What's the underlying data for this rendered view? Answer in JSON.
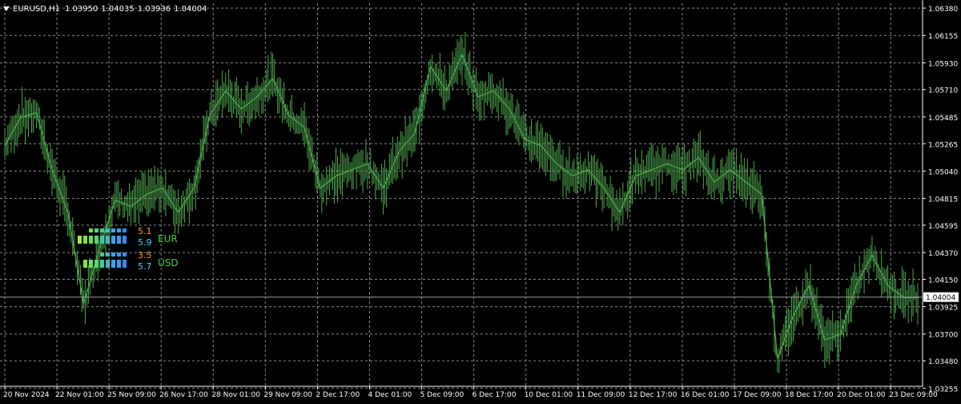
{
  "header": {
    "symbol": "EURUSD,H1",
    "open": "1.03950",
    "high": "1.04035",
    "low": "1.03936",
    "close": "1.04004"
  },
  "colors": {
    "background": "#000000",
    "grid": "#8a8a8a",
    "price_line": "#4fa84f",
    "axis": "#ffffff",
    "ask_line": "#ffffff",
    "strength_orange": "#ff9a30",
    "strength_cyan": "#40d8ff",
    "strength_label": "#40d040"
  },
  "strength_meter": {
    "rows": [
      {
        "currency": "EUR",
        "values": [
          "5.1",
          "5.9"
        ]
      },
      {
        "currency": "USD",
        "values": [
          "3.5",
          "5.7"
        ]
      }
    ]
  },
  "chart_data": {
    "type": "line",
    "title": "",
    "xlabel": "",
    "ylabel": "",
    "ylim": [
      1.0327,
      1.0642
    ],
    "y_ticks": [
      "1.06380",
      "1.06155",
      "1.05930",
      "1.05710",
      "1.05485",
      "1.05265",
      "1.05040",
      "1.04815",
      "1.04595",
      "1.04370",
      "1.04150",
      "1.03925",
      "1.03700",
      "1.03480",
      "1.03255"
    ],
    "x_ticks": [
      "20 Nov 2024",
      "22 Nov 01:00",
      "25 Nov 09:00",
      "26 Nov 17:00",
      "28 Nov 01:00",
      "29 Nov 09:00",
      "2 Dec 17:00",
      "4 Dec 01:00",
      "5 Dec 09:00",
      "6 Dec 17:00",
      "10 Dec 01:00",
      "11 Dec 09:00",
      "12 Dec 17:00",
      "16 Dec 01:00",
      "17 Dec 09:00",
      "18 Dec 17:00",
      "20 Dec 01:00",
      "23 Dec 09:00"
    ],
    "current_price": "1.04004",
    "grid": true,
    "series": [
      {
        "values": [
          {
            "x": "20 Nov 2024",
            "y": 1.0525
          },
          {
            "x": "20 Nov 18:00",
            "y": 1.0548
          },
          {
            "x": "21 Nov 06:00",
            "y": 1.0552
          },
          {
            "x": "21 Nov 18:00",
            "y": 1.0505
          },
          {
            "x": "22 Nov 01:00",
            "y": 1.047
          },
          {
            "x": "22 Nov 08:00",
            "y": 1.0395
          },
          {
            "x": "22 Nov 16:00",
            "y": 1.044
          },
          {
            "x": "25 Nov 01:00",
            "y": 1.048
          },
          {
            "x": "25 Nov 09:00",
            "y": 1.0475
          },
          {
            "x": "25 Nov 18:00",
            "y": 1.0485
          },
          {
            "x": "26 Nov 06:00",
            "y": 1.049
          },
          {
            "x": "26 Nov 17:00",
            "y": 1.047
          },
          {
            "x": "27 Nov 04:00",
            "y": 1.049
          },
          {
            "x": "27 Nov 14:00",
            "y": 1.055
          },
          {
            "x": "28 Nov 01:00",
            "y": 1.057
          },
          {
            "x": "28 Nov 14:00",
            "y": 1.0555
          },
          {
            "x": "29 Nov 01:00",
            "y": 1.0565
          },
          {
            "x": "29 Nov 09:00",
            "y": 1.058
          },
          {
            "x": "29 Nov 20:00",
            "y": 1.055
          },
          {
            "x": "2 Dec 06:00",
            "y": 1.054
          },
          {
            "x": "2 Dec 17:00",
            "y": 1.049
          },
          {
            "x": "3 Dec 06:00",
            "y": 1.05
          },
          {
            "x": "3 Dec 18:00",
            "y": 1.0505
          },
          {
            "x": "4 Dec 01:00",
            "y": 1.051
          },
          {
            "x": "4 Dec 12:00",
            "y": 1.049
          },
          {
            "x": "4 Dec 22:00",
            "y": 1.052
          },
          {
            "x": "5 Dec 09:00",
            "y": 1.0535
          },
          {
            "x": "5 Dec 20:00",
            "y": 1.059
          },
          {
            "x": "6 Dec 06:00",
            "y": 1.057
          },
          {
            "x": "6 Dec 12:00",
            "y": 1.06
          },
          {
            "x": "6 Dec 17:00",
            "y": 1.0565
          },
          {
            "x": "9 Dec 06:00",
            "y": 1.057
          },
          {
            "x": "9 Dec 18:00",
            "y": 1.0555
          },
          {
            "x": "10 Dec 01:00",
            "y": 1.053
          },
          {
            "x": "10 Dec 12:00",
            "y": 1.0525
          },
          {
            "x": "11 Dec 01:00",
            "y": 1.051
          },
          {
            "x": "11 Dec 09:00",
            "y": 1.05
          },
          {
            "x": "11 Dec 20:00",
            "y": 1.0505
          },
          {
            "x": "12 Dec 08:00",
            "y": 1.049
          },
          {
            "x": "12 Dec 17:00",
            "y": 1.047
          },
          {
            "x": "13 Dec 06:00",
            "y": 1.05
          },
          {
            "x": "13 Dec 18:00",
            "y": 1.0505
          },
          {
            "x": "16 Dec 01:00",
            "y": 1.051
          },
          {
            "x": "16 Dec 12:00",
            "y": 1.0505
          },
          {
            "x": "16 Dec 22:00",
            "y": 1.0515
          },
          {
            "x": "17 Dec 09:00",
            "y": 1.0495
          },
          {
            "x": "17 Dec 20:00",
            "y": 1.0505
          },
          {
            "x": "18 Dec 10:00",
            "y": 1.0495
          },
          {
            "x": "18 Dec 17:00",
            "y": 1.0485
          },
          {
            "x": "19 Dec 01:00",
            "y": 1.035
          },
          {
            "x": "19 Dec 12:00",
            "y": 1.0385
          },
          {
            "x": "19 Dec 22:00",
            "y": 1.041
          },
          {
            "x": "20 Dec 01:00",
            "y": 1.0365
          },
          {
            "x": "20 Dec 14:00",
            "y": 1.037
          },
          {
            "x": "20 Dec 22:00",
            "y": 1.041
          },
          {
            "x": "23 Dec 01:00",
            "y": 1.0435
          },
          {
            "x": "23 Dec 09:00",
            "y": 1.041
          },
          {
            "x": "23 Dec 18:00",
            "y": 1.04
          },
          {
            "x": "24 Dec 02:00",
            "y": 1.04
          }
        ]
      }
    ]
  }
}
